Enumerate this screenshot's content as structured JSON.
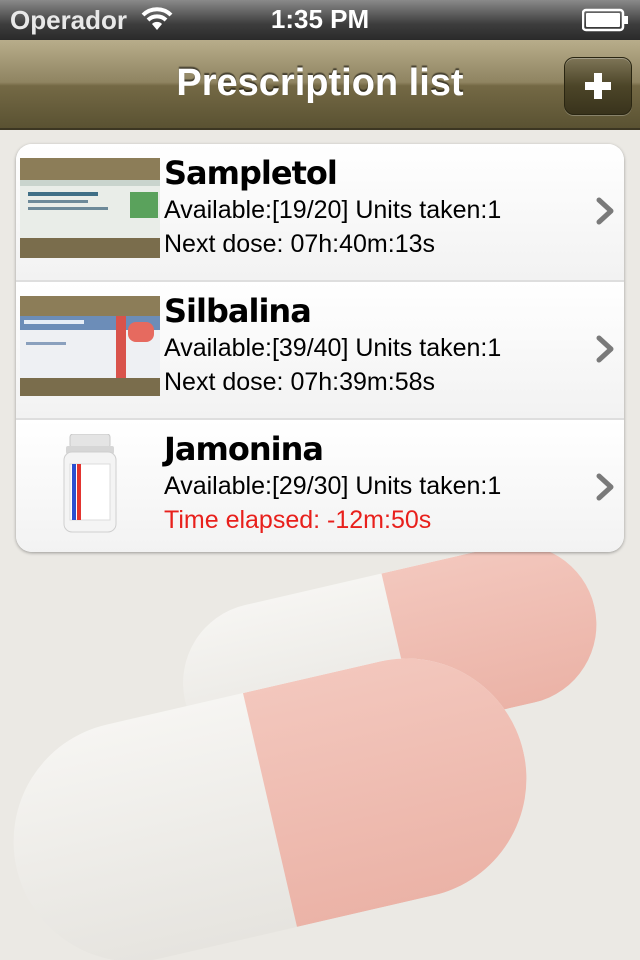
{
  "status_bar": {
    "carrier": "Operador",
    "time": "1:35 PM",
    "wifi_icon": "wifi-icon",
    "battery_icon": "battery-icon"
  },
  "nav": {
    "title": "Prescription list",
    "add_button_icon": "plus-icon"
  },
  "prescriptions": [
    {
      "name": "Sampletol",
      "available": "Available:[19/20] Units taken:1",
      "status": "Next dose: 07h:40m:13s",
      "status_color": "#000000",
      "image": "medicine-box-photo"
    },
    {
      "name": "Silbalina",
      "available": "Available:[39/40] Units taken:1",
      "status": "Next dose: 07h:39m:58s",
      "status_color": "#000000",
      "image": "medicine-box-photo"
    },
    {
      "name": "Jamonina",
      "available": "Available:[29/30] Units taken:1",
      "status": "Time elapsed: -12m:50s",
      "status_color": "#e8201c",
      "image": "pill-bottle-icon"
    }
  ],
  "colors": {
    "navbar": "#8f8461",
    "alert": "#e8201c",
    "background": "#ebe9e4"
  }
}
